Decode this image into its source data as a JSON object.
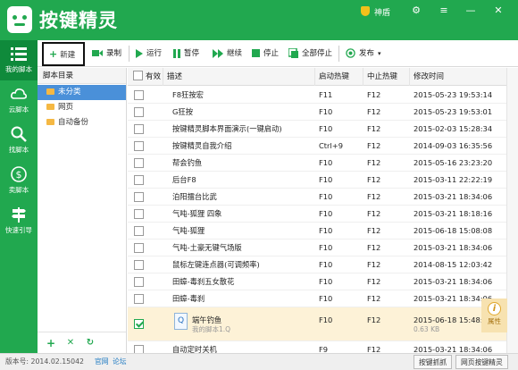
{
  "app": {
    "title": "按键精灵",
    "shield_label": "神盾"
  },
  "window_controls": [
    "⚙",
    "≡",
    "—",
    "✕"
  ],
  "nav": [
    {
      "id": "my-scripts",
      "label": "我的脚本",
      "icon": "list-icon"
    },
    {
      "id": "cloud-scripts",
      "label": "云脚本",
      "icon": "cloud-icon"
    },
    {
      "id": "find-scripts",
      "label": "找脚本",
      "icon": "search-icon"
    },
    {
      "id": "sell-scripts",
      "label": "卖脚本",
      "icon": "dollar-icon"
    },
    {
      "id": "quick-guide",
      "label": "快速引导",
      "icon": "signpost-icon"
    }
  ],
  "toolbar": {
    "new": "新建",
    "record": "录制",
    "run": "运行",
    "pause": "暂停",
    "resume": "继续",
    "stop": "停止",
    "stop_all": "全部停止",
    "publish": "发布"
  },
  "tree": {
    "header": "脚本目录",
    "items": [
      {
        "label": "未分类",
        "selected": true
      },
      {
        "label": "网页",
        "selected": false
      },
      {
        "label": "自动备份",
        "selected": false
      }
    ]
  },
  "grid": {
    "columns": {
      "enabled": "有效",
      "desc": "描述",
      "start_key": "启动热键",
      "stop_key": "中止热键",
      "modified": "修改时间"
    },
    "rows": [
      {
        "checked": false,
        "desc": "F8狂按宏",
        "start": "F11",
        "stop": "F12",
        "time": "2015-05-23 19:53:14"
      },
      {
        "checked": false,
        "desc": "G狂按",
        "start": "F10",
        "stop": "F12",
        "time": "2015-05-23 19:53:01"
      },
      {
        "checked": false,
        "desc": "按键精灵脚本界面演示(一键启动)",
        "start": "F10",
        "stop": "F12",
        "time": "2015-02-03 15:28:34"
      },
      {
        "checked": false,
        "desc": "按键精灵自我介绍",
        "start": "Ctrl+9",
        "stop": "F12",
        "time": "2014-09-03 16:35:56"
      },
      {
        "checked": false,
        "desc": "帮会钓鱼",
        "start": "F10",
        "stop": "F12",
        "time": "2015-05-16 23:23:20"
      },
      {
        "checked": false,
        "desc": "后台F8",
        "start": "F10",
        "stop": "F12",
        "time": "2015-03-11 22:22:19"
      },
      {
        "checked": false,
        "desc": "泊阳擂台比武",
        "start": "F10",
        "stop": "F12",
        "time": "2015-03-21 18:34:06"
      },
      {
        "checked": false,
        "desc": "气吨-狐狸 四象",
        "start": "F10",
        "stop": "F12",
        "time": "2015-03-21 18:18:16"
      },
      {
        "checked": false,
        "desc": "气吨-狐狸",
        "start": "F10",
        "stop": "F12",
        "time": "2015-06-18 15:08:08"
      },
      {
        "checked": false,
        "desc": "气吨-土豪无键气场版",
        "start": "F10",
        "stop": "F12",
        "time": "2015-03-21 18:34:06"
      },
      {
        "checked": false,
        "desc": "鼠标左键连点器(可调频率)",
        "start": "F10",
        "stop": "F12",
        "time": "2014-08-15 12:03:42"
      },
      {
        "checked": false,
        "desc": "田蟑-毒刹五女散花",
        "start": "F10",
        "stop": "F12",
        "time": "2015-03-21 18:34:06"
      },
      {
        "checked": false,
        "desc": "田蟑-毒刹",
        "start": "F10",
        "stop": "F12",
        "time": "2015-03-21 18:34:06"
      },
      {
        "checked": true,
        "desc": "端午钓鱼",
        "sub": "我的脚本1.Q",
        "start": "F10",
        "stop": "F12",
        "time": "2015-06-18 15:48:44",
        "time_sub": "0.63 KB",
        "icon": "Q"
      },
      {
        "checked": false,
        "desc": "自动定时关机",
        "start": "F9",
        "stop": "F12",
        "time": "2015-03-21 18:34:06"
      }
    ]
  },
  "properties": {
    "icon": "i",
    "label": "属性"
  },
  "statusbar": {
    "version": "版本号: 2014.02.15042",
    "official_site": "官网",
    "forum": "论坛",
    "btn_capture": "按键抓抓",
    "btn_web": "网页按键精灵"
  }
}
